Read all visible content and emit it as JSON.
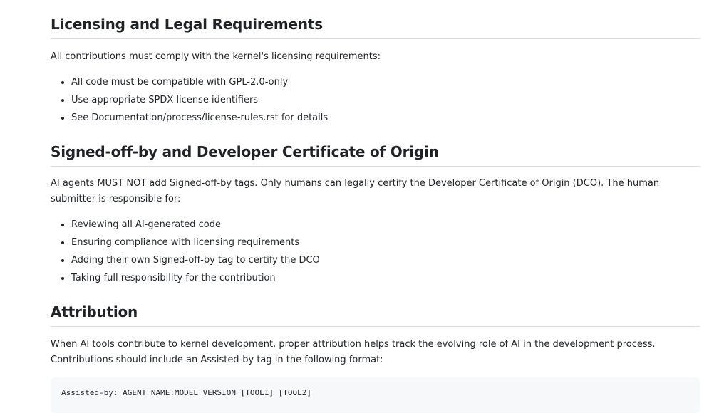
{
  "sections": {
    "licensing": {
      "heading": "Licensing and Legal Requirements",
      "intro": "All contributions must comply with the kernel's licensing requirements:",
      "items": [
        "All code must be compatible with GPL-2.0-only",
        "Use appropriate SPDX license identifiers",
        "See Documentation/process/license-rules.rst for details"
      ]
    },
    "signed_off": {
      "heading": "Signed-off-by and Developer Certificate of Origin",
      "intro": "AI agents MUST NOT add Signed-off-by tags. Only humans can legally certify the Developer Certificate of Origin (DCO). The human submitter is responsible for:",
      "items": [
        "Reviewing all AI-generated code",
        "Ensuring compliance with licensing requirements",
        "Adding their own Signed-off-by tag to certify the DCO",
        "Taking full responsibility for the contribution"
      ]
    },
    "attribution": {
      "heading": "Attribution",
      "intro": "When AI tools contribute to kernel development, proper attribution helps track the evolving role of AI in the development process. Contributions should include an Assisted-by tag in the following format:",
      "code": "Assisted-by: AGENT_NAME:MODEL_VERSION [TOOL1] [TOOL2]"
    }
  }
}
